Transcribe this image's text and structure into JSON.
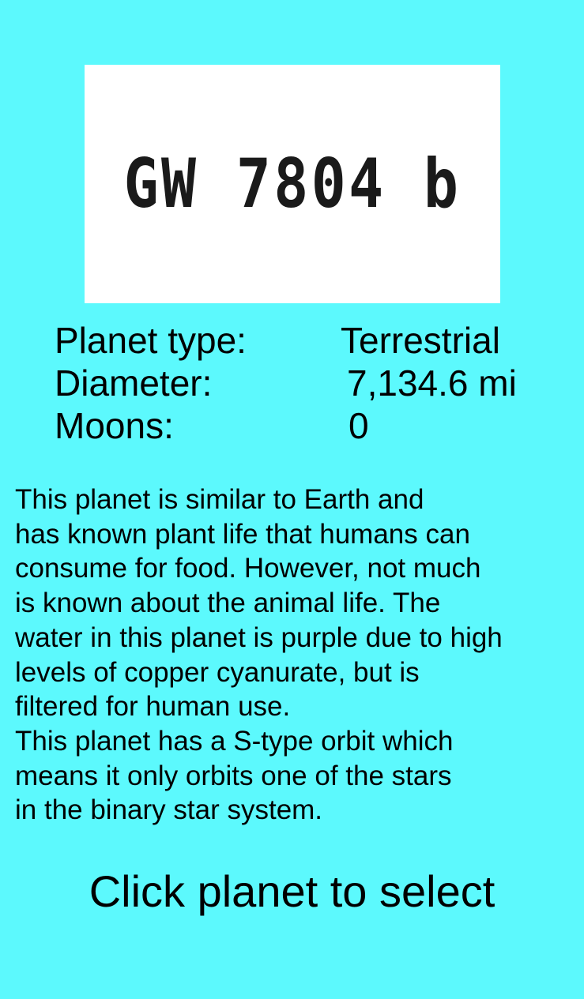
{
  "planet": {
    "name": "GW 7804 b"
  },
  "stats": {
    "type_label": "Planet type:",
    "type_value": "Terrestrial",
    "diameter_label": "Diameter:",
    "diameter_value": "7,134.6 mi",
    "moons_label": "Moons:",
    "moons_value": "0"
  },
  "description": {
    "lines": [
      "This planet is similar to Earth and",
      "has known plant life that humans can",
      "consume for food. However, not much",
      "is known about the animal life. The",
      "water in this planet is purple due to high",
      "levels of copper cyanurate, but is",
      "filtered for human use.",
      "This planet has a S-type orbit which",
      "means it only orbits one of the stars",
      "in the binary star system."
    ]
  },
  "action": {
    "select_label": "Click planet to select"
  },
  "colors": {
    "background": "#5cf9fd",
    "card": "#ffffff",
    "text": "#000000"
  }
}
